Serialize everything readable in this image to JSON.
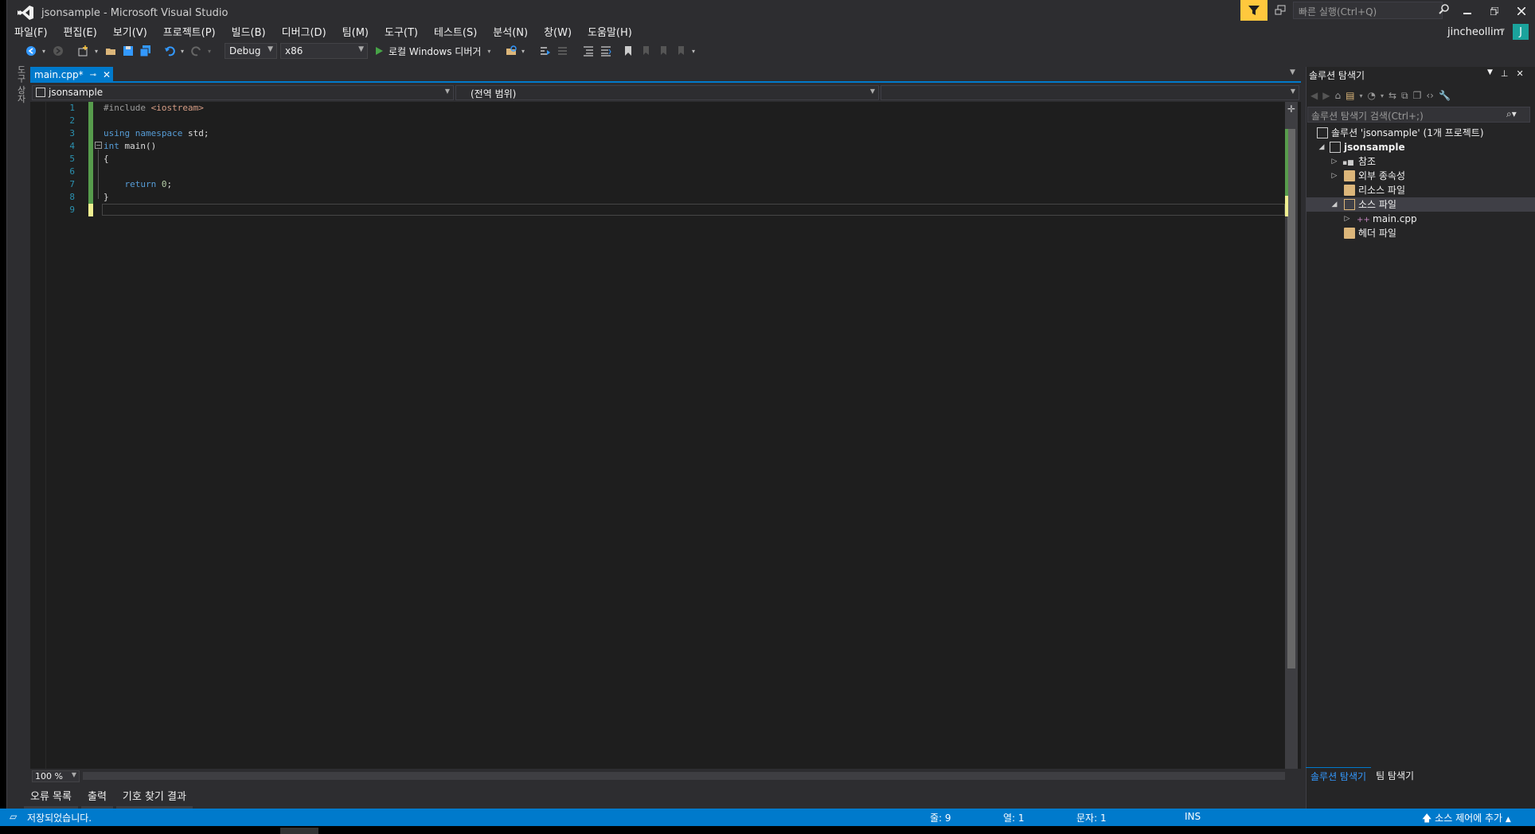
{
  "window": {
    "title": "jsonsample - Microsoft Visual Studio",
    "quick_launch_placeholder": "빠른 실행(Ctrl+Q)",
    "user": "jincheollim",
    "user_initial": "J"
  },
  "menu": [
    "파일(F)",
    "편집(E)",
    "보기(V)",
    "프로젝트(P)",
    "빌드(B)",
    "디버그(D)",
    "팀(M)",
    "도구(T)",
    "테스트(S)",
    "분석(N)",
    "창(W)",
    "도움말(H)"
  ],
  "toolbar": {
    "config": "Debug",
    "platform": "x86",
    "run_label": "로컬 Windows 디버거"
  },
  "side_tab_label": "도구 상자",
  "editor": {
    "tab_label": "main.cpp*",
    "nav_project": "jsonsample",
    "nav_scope": "(전역 범위)",
    "nav_member": "",
    "zoom": "100 %",
    "line_numbers": [
      "1",
      "2",
      "3",
      "4",
      "5",
      "6",
      "7",
      "8",
      "9"
    ],
    "code": {
      "l1_pp": "#include ",
      "l1_str": "<iostream>",
      "l3_kw1": "using",
      "l3_kw2": "namespace",
      "l3_rest": " std;",
      "l4_kw": "int",
      "l4_rest": " main()",
      "l5": "{",
      "l7_kw": "return",
      "l7_num": "0",
      "l7_semi": ";",
      "l8": "}"
    }
  },
  "bottom_tabs": [
    "오류 목록",
    "출력",
    "기호 찾기 결과"
  ],
  "status": {
    "message": "저장되었습니다.",
    "line": "줄: 9",
    "col": "열: 1",
    "char": "문자: 1",
    "ins": "INS",
    "source_control": "소스 제어에 추가"
  },
  "solution_explorer": {
    "title": "솔루션 탐색기",
    "search_placeholder": "솔루션 탐색기 검색(Ctrl+;)",
    "items": [
      {
        "label": "솔루션 'jsonsample' (1개 프로젝트)"
      },
      {
        "label": "jsonsample"
      },
      {
        "label": "참조"
      },
      {
        "label": "외부 종속성"
      },
      {
        "label": "리소스 파일"
      },
      {
        "label": "소스 파일"
      },
      {
        "label": "main.cpp"
      },
      {
        "label": "헤더 파일"
      }
    ],
    "tabs": [
      "솔루션 탐색기",
      "팀 탐색기"
    ]
  },
  "colors": {
    "accent": "#007acc",
    "filter": "#ffc83d",
    "changed_saved": "#579c4c",
    "changed_unsaved": "#efef91"
  }
}
